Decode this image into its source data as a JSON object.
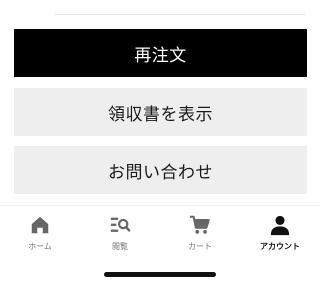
{
  "actions": {
    "reorder_label": "再注文",
    "receipt_label": "領収書を表示",
    "contact_label": "お問い合わせ"
  },
  "tabbar": {
    "items": [
      {
        "label": "ホーム",
        "icon": "home-icon"
      },
      {
        "label": "閲覧",
        "icon": "browse-icon"
      },
      {
        "label": "カート",
        "icon": "cart-icon"
      },
      {
        "label": "アカウント",
        "icon": "account-icon",
        "active": true
      }
    ],
    "active_color": "#111111",
    "inactive_color": "#777777"
  },
  "colors": {
    "primary_button": "#000000",
    "secondary_button": "#eeeeee"
  }
}
